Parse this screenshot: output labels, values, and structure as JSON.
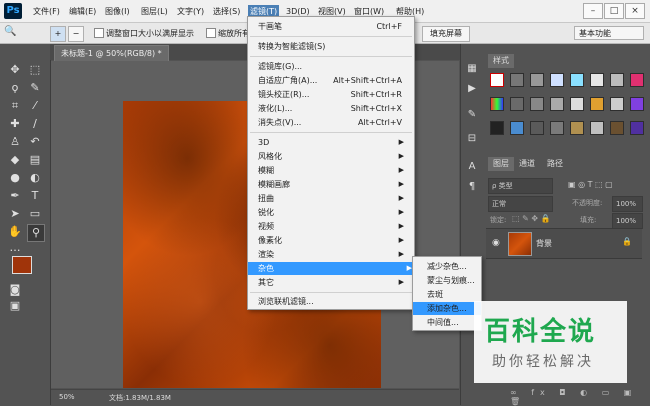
{
  "app": {
    "logo": "Ps"
  },
  "menubar": {
    "items": [
      "文件(F)",
      "编辑(E)",
      "图像(I)",
      "图层(L)",
      "文字(Y)",
      "选择(S)",
      "滤镜(T)",
      "3D(D)",
      "视图(V)",
      "窗口(W)",
      "帮助(H)"
    ],
    "active": "滤镜(T)",
    "window_controls": [
      "–",
      "□",
      "×"
    ]
  },
  "options": {
    "zoom_icon": "🔍",
    "check1_label": "调整窗口大小以满屏显示",
    "check2_label": "缩放所有",
    "fill_screen": "填充屏幕",
    "workspace": "基本功能"
  },
  "document": {
    "tab_title": "未标题-1 @ 50%(RGB/8) *",
    "zoom": "50%",
    "doc_info": "文档:1.83M/1.83M"
  },
  "filter_menu": {
    "top": [
      {
        "label": "干画笔",
        "shortcut": "Ctrl+F"
      }
    ],
    "group2": [
      {
        "label": "转换为智能滤镜(S)",
        "shortcut": ""
      }
    ],
    "group3": [
      {
        "label": "滤镜库(G)...",
        "shortcut": ""
      },
      {
        "label": "自适应广角(A)...",
        "shortcut": "Alt+Shift+Ctrl+A"
      },
      {
        "label": "镜头校正(R)...",
        "shortcut": "Shift+Ctrl+R"
      },
      {
        "label": "液化(L)...",
        "shortcut": "Shift+Ctrl+X"
      },
      {
        "label": "消失点(V)...",
        "shortcut": "Alt+Ctrl+V"
      }
    ],
    "submenus": [
      "3D",
      "风格化",
      "模糊",
      "模糊画廊",
      "扭曲",
      "锐化",
      "视频",
      "像素化",
      "渲染",
      "杂色",
      "其它"
    ],
    "highlighted": "杂色",
    "browse": "浏览联机滤镜..."
  },
  "noise_submenu": {
    "items": [
      "减少杂色...",
      "蒙尘与划痕...",
      "去斑",
      "添加杂色...",
      "中间值..."
    ],
    "highlighted": "添加杂色..."
  },
  "styles_panel": {
    "tab": "样式"
  },
  "layers_panel": {
    "tabs": [
      "图层",
      "通道",
      "路径"
    ],
    "kind_label": "ρ 类型",
    "blend_mode": "正常",
    "opacity_label": "不透明度:",
    "opacity": "100%",
    "lock_label": "锁定:",
    "fill_label": "填充:",
    "fill": "100%",
    "layer_name": "背景"
  },
  "watermark": {
    "title": "百科全说",
    "subtitle": "助你轻松解决"
  },
  "colors": {
    "accent": "#3399ff",
    "foreground": "#a0340a",
    "background": "#3a1a08",
    "watermark_green": "#1fa84f"
  }
}
